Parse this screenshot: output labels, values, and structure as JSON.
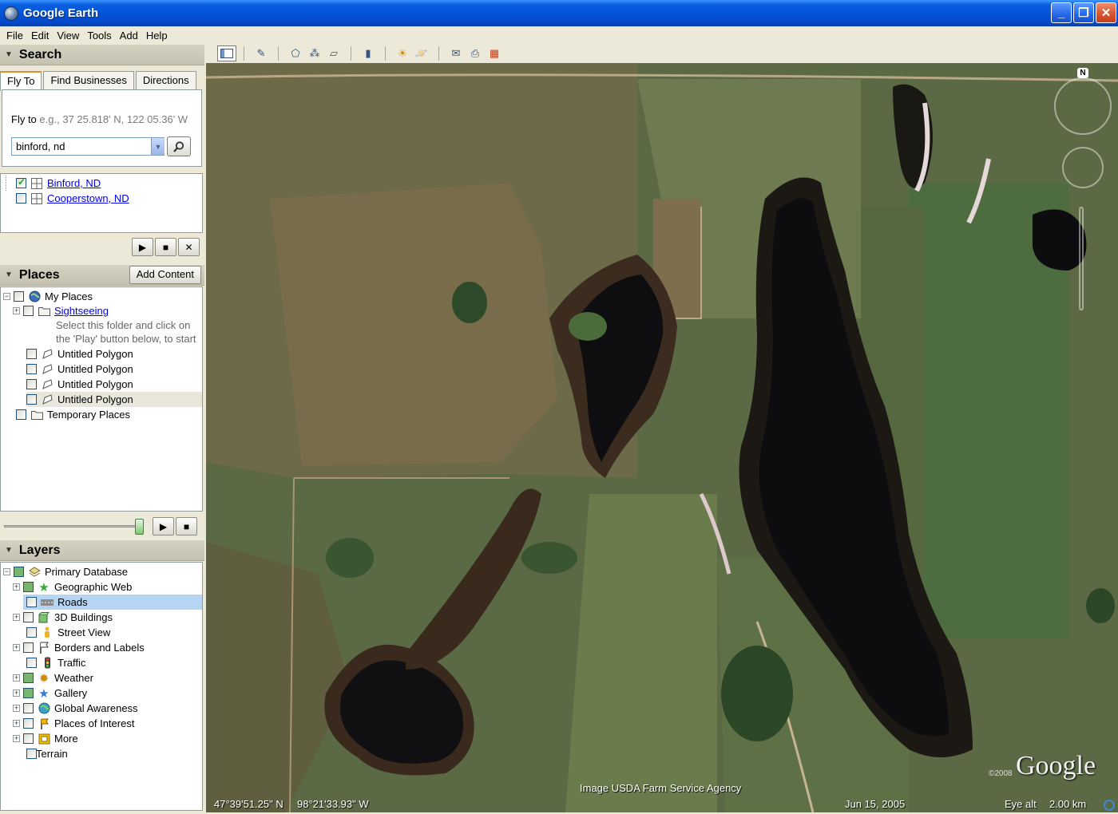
{
  "window": {
    "title": "Google Earth"
  },
  "menu": [
    "File",
    "Edit",
    "View",
    "Tools",
    "Add",
    "Help"
  ],
  "search": {
    "header": "Search",
    "tabs": [
      "Fly To",
      "Find Businesses",
      "Directions"
    ],
    "fly_label": "Fly to",
    "fly_hint": "e.g., 37 25.818' N, 122 05.36' W",
    "input_value": "binford, nd",
    "results": [
      {
        "label": "Binford, ND",
        "checked": true
      },
      {
        "label": "Cooperstown, ND",
        "checked": false
      }
    ]
  },
  "places": {
    "header": "Places",
    "add_content": "Add Content",
    "my_places": "My Places",
    "sightseeing": "Sightseeing",
    "hint_line1": "Select this folder and click on",
    "hint_line2": "the 'Play' button below, to start",
    "polygons": [
      "Untitled Polygon",
      "Untitled Polygon",
      "Untitled Polygon",
      "Untitled Polygon"
    ],
    "temporary": "Temporary Places"
  },
  "layers": {
    "header": "Layers",
    "items": [
      {
        "label": "Primary Database",
        "icon": "database-icon"
      },
      {
        "label": "Geographic Web",
        "icon": "star-icon"
      },
      {
        "label": "Roads",
        "icon": "road-icon"
      },
      {
        "label": "3D Buildings",
        "icon": "building-icon"
      },
      {
        "label": "Street View",
        "icon": "person-icon"
      },
      {
        "label": "Borders and Labels",
        "icon": "flag-icon"
      },
      {
        "label": "Traffic",
        "icon": "traffic-light-icon"
      },
      {
        "label": "Weather",
        "icon": "sun-icon"
      },
      {
        "label": "Gallery",
        "icon": "star-icon"
      },
      {
        "label": "Global Awareness",
        "icon": "globe-icon"
      },
      {
        "label": "Places of Interest",
        "icon": "pin-icon"
      },
      {
        "label": "More",
        "icon": "folder-icon"
      },
      {
        "label": "Terrain",
        "icon": ""
      }
    ]
  },
  "map": {
    "credit": "Image USDA Farm Service Agency",
    "logo": "Google",
    "copyright": "©2008",
    "compass": "N",
    "lat": "47°39'51.25\" N",
    "lon": "98°21'33.93\" W",
    "date": "Jun 15, 2005",
    "eye_alt_label": "Eye alt",
    "eye_alt_value": "2.00 km"
  },
  "colors": {
    "title_bar": "#0554d8",
    "selection": "#b6d5f5",
    "link": "#0000ee"
  }
}
